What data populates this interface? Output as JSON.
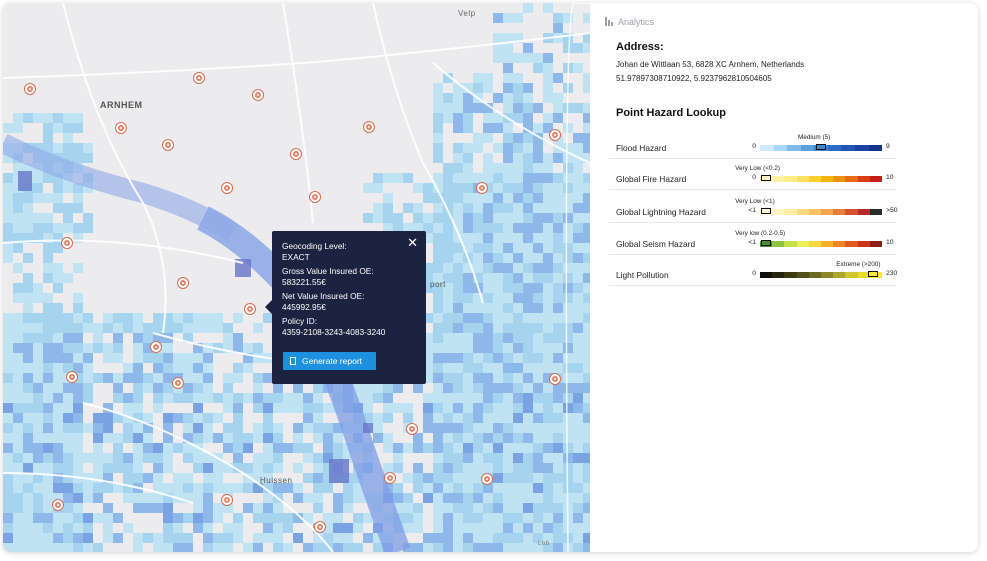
{
  "map": {
    "labels": [
      {
        "id": "arnhem",
        "text": "ARNHEM"
      },
      {
        "id": "velp",
        "text": "Velp"
      },
      {
        "id": "port",
        "text": "port"
      },
      {
        "id": "huissen",
        "text": "Huissen"
      },
      {
        "id": "lob",
        "text": "Lob"
      }
    ],
    "markers_count": 25
  },
  "popup": {
    "geocoding_label": "Geocoding Level:",
    "geocoding_value": "EXACT",
    "gross_label": "Gross Value Insured OE:",
    "gross_value": "583221.55€",
    "net_label": "Net Value Insured OE:",
    "net_value": "445992.95€",
    "policy_label": "Policy ID:",
    "policy_value": "4359-2108-3243-4083-3240",
    "button_label": "Generate report",
    "close_icon": "close-icon"
  },
  "panel": {
    "tab_label": "Analytics",
    "address_title": "Address:",
    "address_line": "Johan de Wittlaan 53, 6828 XC Arnhem, Netherlands",
    "coordinates": "51.97897308710922, 5.9237962810504605",
    "hazard_title": "Point Hazard Lookup",
    "hazards": [
      {
        "name": "Flood Hazard",
        "min": "0",
        "max": "9",
        "level": "Medium (5)",
        "position": 0.5,
        "colors": [
          "#cfe9f8",
          "#a9d6f2",
          "#7fbde9",
          "#5aa2de",
          "#3f86d2",
          "#2d6cc4",
          "#2355b3",
          "#1c43a1",
          "#16338f"
        ]
      },
      {
        "name": "Global Fire Hazard",
        "min": "0",
        "max": "10",
        "level": "Very Low (<0.2)",
        "position": 0.05,
        "colors": [
          "#fff7c8",
          "#fff2a8",
          "#ffee88",
          "#fde15a",
          "#f8cf2c",
          "#f3b40f",
          "#ed9211",
          "#e56a13",
          "#d83d14",
          "#c81e18"
        ]
      },
      {
        "name": "Global Lightning Hazard",
        "min": "<1",
        "max": ">50",
        "level": "Very Low (<1)",
        "position": 0.05,
        "colors": [
          "#fff9dd",
          "#fff3c4",
          "#feeaa2",
          "#fcd980",
          "#f8c162",
          "#f3a44c",
          "#e87d3b",
          "#d4502f",
          "#b72a2a",
          "#2b2b2b"
        ]
      },
      {
        "name": "Global Seism Hazard",
        "min": "<1",
        "max": "10",
        "level": "Very low (0.2-0.5)",
        "position": 0.05,
        "colors": [
          "#4a8f2f",
          "#8cc43f",
          "#c5df49",
          "#ecee53",
          "#f8d93a",
          "#f6b12b",
          "#ee8625",
          "#e05a1f",
          "#cc3417",
          "#8e1d0f"
        ]
      },
      {
        "name": "Light Pollution",
        "min": "0",
        "max": "230",
        "level": "Extreme (>200)",
        "position": 0.93,
        "colors": [
          "#0e0e0a",
          "#25240f",
          "#3b3a14",
          "#525019",
          "#6b6a20",
          "#8b8726",
          "#ada62c",
          "#cfc52f",
          "#e8dc2c",
          "#f9ec2a"
        ]
      }
    ]
  }
}
